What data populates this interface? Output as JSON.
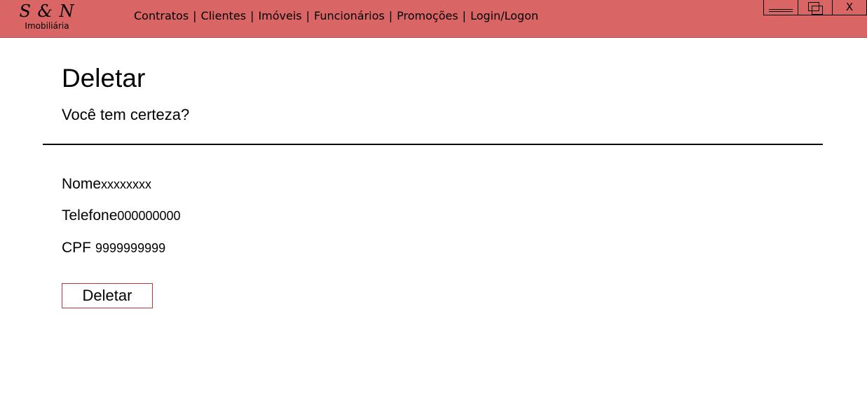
{
  "brand": {
    "logo": "S & N",
    "subtitle": "Imobiliária"
  },
  "nav": {
    "items": [
      "Contratos",
      "Clientes",
      "Imóveis",
      "Funcionários",
      "Promoções",
      "Login/Logon"
    ],
    "separator": "|"
  },
  "window_controls": {
    "close_label": "X"
  },
  "page": {
    "title": "Deletar",
    "subtitle": "Você tem certeza?"
  },
  "fields": {
    "nome_label": "Nome",
    "nome_value": "xxxxxxxx",
    "telefone_label": "Telefone",
    "telefone_value": "000000000",
    "cpf_label": "CPF",
    "cpf_value": "9999999999"
  },
  "actions": {
    "delete_label": "Deletar"
  },
  "colors": {
    "header_bg": "#d96565",
    "button_border": "#b03a3a"
  }
}
